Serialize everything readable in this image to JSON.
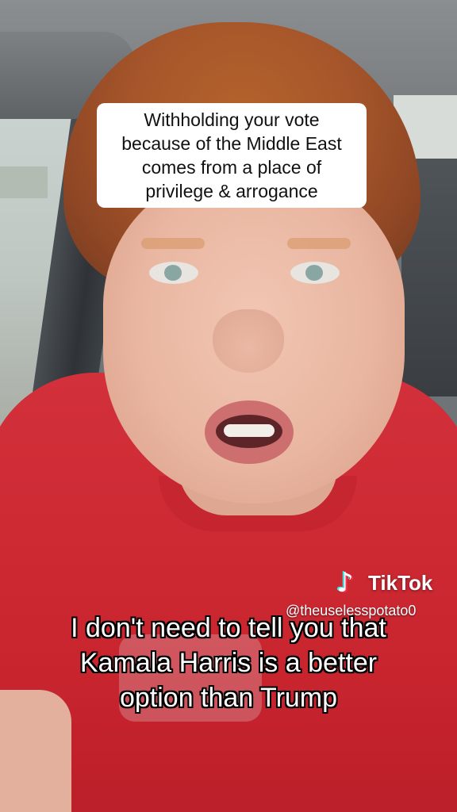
{
  "video": {
    "top_caption": "Withholding your vote\nbecause of the Middle East\ncomes from a place of\nprivilege & arrogance",
    "bottom_caption": "I don't need to tell you that\nKamala Harris is a better\noption than Trump"
  },
  "watermark": {
    "brand": "TikTok",
    "handle": "@theuselesspotato0",
    "icon": "tiktok-note-icon"
  },
  "colors": {
    "shirt": "#c9252f",
    "caption_box": "#ffffff",
    "caption_text": "#111111",
    "subtitle_text": "#ffffff",
    "tiktok_cyan": "#25f4ee",
    "tiktok_red": "#fe2c55"
  }
}
